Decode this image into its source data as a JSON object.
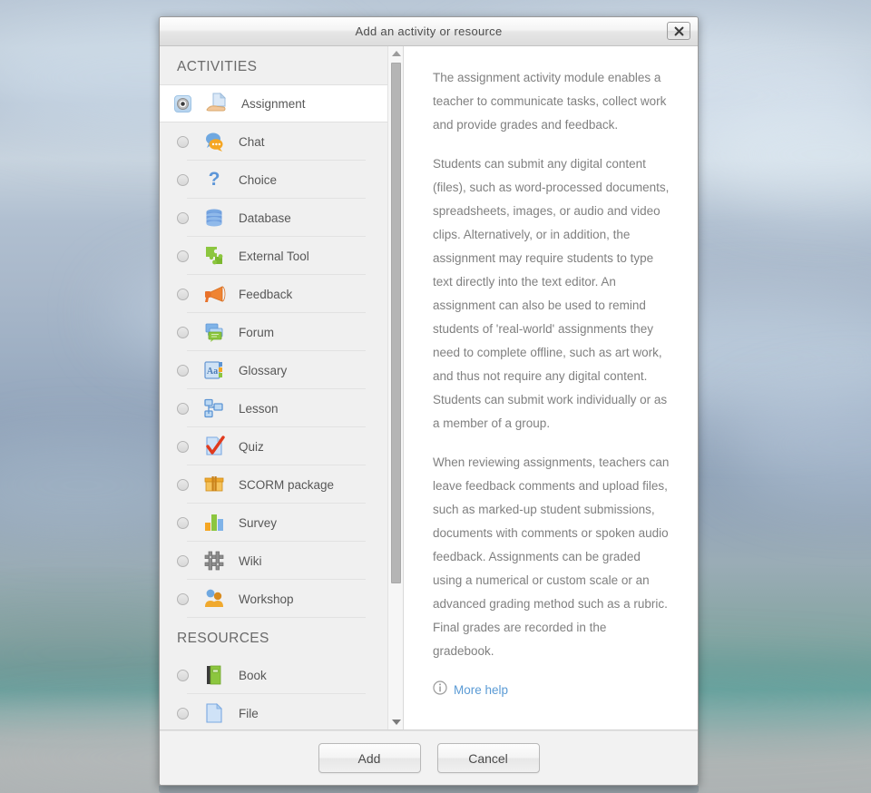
{
  "dialog": {
    "title": "Add an activity or resource",
    "close_label": "Close",
    "close_icon": "close-icon"
  },
  "chooser": {
    "groups": [
      {
        "heading": "ACTIVITIES",
        "items": [
          {
            "label": "Assignment",
            "icon": "assignment-icon",
            "selected": true
          },
          {
            "label": "Chat",
            "icon": "chat-icon",
            "selected": false
          },
          {
            "label": "Choice",
            "icon": "choice-icon",
            "selected": false
          },
          {
            "label": "Database",
            "icon": "database-icon",
            "selected": false
          },
          {
            "label": "External Tool",
            "icon": "external-tool-icon",
            "selected": false
          },
          {
            "label": "Feedback",
            "icon": "feedback-icon",
            "selected": false
          },
          {
            "label": "Forum",
            "icon": "forum-icon",
            "selected": false
          },
          {
            "label": "Glossary",
            "icon": "glossary-icon",
            "selected": false
          },
          {
            "label": "Lesson",
            "icon": "lesson-icon",
            "selected": false
          },
          {
            "label": "Quiz",
            "icon": "quiz-icon",
            "selected": false
          },
          {
            "label": "SCORM package",
            "icon": "scorm-icon",
            "selected": false
          },
          {
            "label": "Survey",
            "icon": "survey-icon",
            "selected": false
          },
          {
            "label": "Wiki",
            "icon": "wiki-icon",
            "selected": false
          },
          {
            "label": "Workshop",
            "icon": "workshop-icon",
            "selected": false
          }
        ]
      },
      {
        "heading": "RESOURCES",
        "items": [
          {
            "label": "Book",
            "icon": "book-icon",
            "selected": false
          },
          {
            "label": "File",
            "icon": "file-icon",
            "selected": false
          }
        ]
      }
    ],
    "scrollbar": {
      "up_arrow": "arrow-up-icon",
      "down_arrow": "arrow-down-icon"
    }
  },
  "description": {
    "paragraphs": [
      "The assignment activity module enables a teacher to communicate tasks, collect work and provide grades and feedback.",
      "Students can submit any digital content (files), such as word-processed documents, spreadsheets, images, or audio and video clips. Alternatively, or in addition, the assignment may require students to type text directly into the text editor. An assignment can also be used to remind students of 'real-world' assignments they need to complete offline, such as art work, and thus not require any digital content. Students can submit work individually or as a member of a group.",
      "When reviewing assignments, teachers can leave feedback comments and upload files, such as marked-up student submissions, documents with comments or spoken audio feedback. Assignments can be graded using a numerical or custom scale or an advanced grading method such as a rubric. Final grades are recorded in the gradebook."
    ],
    "more_help_label": "More help",
    "more_help_icon": "info-icon"
  },
  "footer": {
    "add_label": "Add",
    "cancel_label": "Cancel"
  },
  "colors": {
    "link": "#5b9bd5",
    "selection_highlight": "#b5d3ee",
    "body_text": "#808080",
    "title_text": "#4d4d4d"
  }
}
